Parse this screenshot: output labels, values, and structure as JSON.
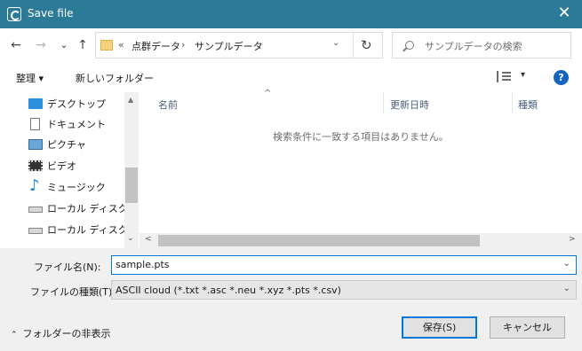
{
  "window": {
    "title": "Save file",
    "close_glyph": "✕"
  },
  "nav": {
    "back": "←",
    "forward": "→",
    "recent": "⌄",
    "up": "↑"
  },
  "address": {
    "overflow": "«",
    "crumbs": [
      "点群データ",
      "サンプルデータ"
    ],
    "separator": "›",
    "dropdown": "⌄",
    "refresh": "↻"
  },
  "search": {
    "placeholder": "サンプルデータの検索"
  },
  "toolbar": {
    "organize": "整理 ▾",
    "new_folder": "新しいフォルダー",
    "view_caret": "▾",
    "help": "?"
  },
  "sidebar": {
    "items": [
      {
        "label": "デスクトップ",
        "icon": "desktop-icon"
      },
      {
        "label": "ドキュメント",
        "icon": "document-icon"
      },
      {
        "label": "ピクチャ",
        "icon": "pictures-icon"
      },
      {
        "label": "ビデオ",
        "icon": "video-icon"
      },
      {
        "label": "ミュージック",
        "icon": "music-icon"
      },
      {
        "label": "ローカル ディスク (C",
        "icon": "drive-icon"
      },
      {
        "label": "ローカル ディスク (D",
        "icon": "drive-icon"
      }
    ]
  },
  "filelist": {
    "columns": [
      "名前",
      "更新日時",
      "種類"
    ],
    "sort_glyph": "^",
    "empty_message": "検索条件に一致する項目はありません。"
  },
  "form": {
    "filename_label": "ファイル名(N):",
    "filename_value": "sample.pts",
    "filetype_label": "ファイルの種類(T):",
    "filetype_value": "ASCII cloud (*.txt *.asc *.neu *.xyz *.pts *.csv)"
  },
  "footer": {
    "hide_folders": "フォルダーの非表示",
    "save": "保存(S)",
    "cancel": "キャンセル"
  },
  "colors": {
    "titlebar": "#2b7a97",
    "accent": "#0078d7"
  }
}
